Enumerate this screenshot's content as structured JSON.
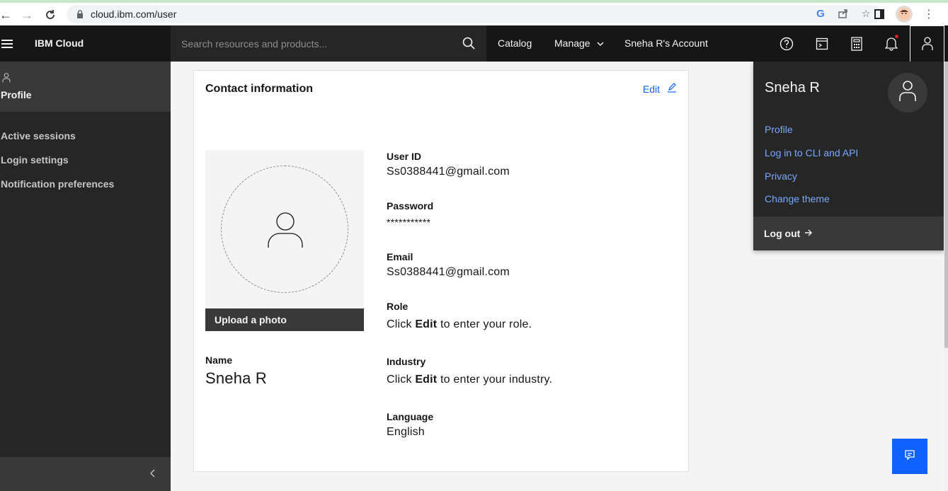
{
  "browser": {
    "url": "cloud.ibm.com/user"
  },
  "header": {
    "brand": "IBM Cloud",
    "search_placeholder": "Search resources and products...",
    "nav": {
      "catalog": "Catalog",
      "manage": "Manage",
      "account": "Sneha R's Account"
    }
  },
  "sidebar": {
    "profile_label": "Profile",
    "items": [
      {
        "label": "Active sessions"
      },
      {
        "label": "Login settings"
      },
      {
        "label": "Notification preferences"
      }
    ]
  },
  "card": {
    "title": "Contact information",
    "edit_label": "Edit",
    "upload_label": "Upload a photo",
    "name_label": "Name",
    "name_value": "Sneha R",
    "fields": {
      "user_id_label": "User ID",
      "user_id_value": "Ss0388441@gmail.com",
      "password_label": "Password",
      "password_value": "***********",
      "email_label": "Email",
      "email_value": "Ss0388441@gmail.com",
      "role_label": "Role",
      "role_prefix": "Click ",
      "role_bold": "Edit",
      "role_suffix": " to enter your role.",
      "industry_label": "Industry",
      "industry_prefix": "Click ",
      "industry_bold": "Edit",
      "industry_suffix": " to enter your industry.",
      "language_label": "Language",
      "language_value": "English"
    }
  },
  "user_panel": {
    "name": "Sneha R",
    "links": [
      {
        "label": "Profile"
      },
      {
        "label": "Log in to CLI and API"
      },
      {
        "label": "Privacy"
      },
      {
        "label": "Change theme"
      }
    ],
    "logout_label": "Log out"
  },
  "colors": {
    "link_blue": "#0f62fe",
    "panel_link": "#78a9ff",
    "header_bg": "#161616"
  }
}
